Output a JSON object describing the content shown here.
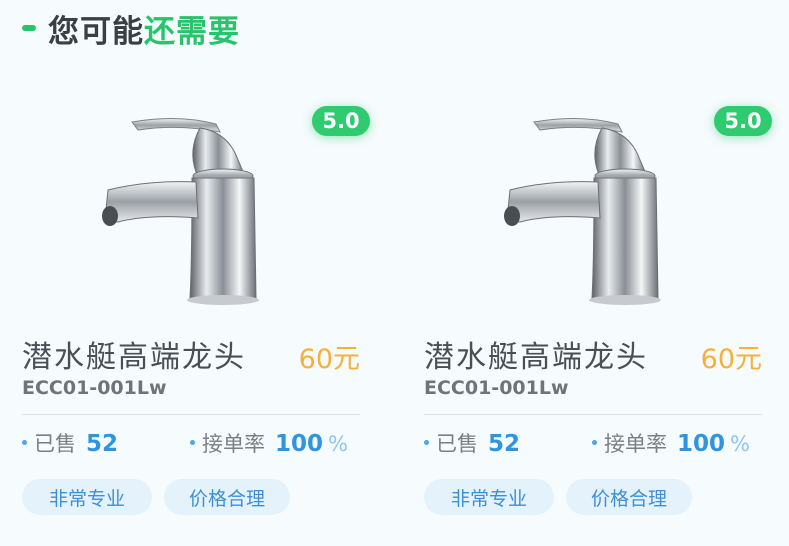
{
  "section": {
    "title_part1": "您可能",
    "title_part2": "还需要"
  },
  "products": [
    {
      "rating": "5.0",
      "name": "潜水艇高端龙头",
      "price": "60元",
      "code": "ECC01-001Lw",
      "sold_label": "已售",
      "sold_value": "52",
      "rate_label": "接单率",
      "rate_value": "100",
      "rate_unit": "%",
      "tags": [
        "非常专业",
        "价格合理"
      ]
    },
    {
      "rating": "5.0",
      "name": "潜水艇高端龙头",
      "price": "60元",
      "code": "ECC01-001Lw",
      "sold_label": "已售",
      "sold_value": "52",
      "rate_label": "接单率",
      "rate_value": "100",
      "rate_unit": "%",
      "tags": [
        "非常专业",
        "价格合理"
      ]
    }
  ],
  "colors": {
    "accent_green": "#27c46b",
    "price_orange": "#f6b03c",
    "stat_blue": "#2f95e0",
    "tag_bg": "#e4f2fc"
  },
  "icons": [
    "faucet-image",
    "bullet-dot"
  ]
}
